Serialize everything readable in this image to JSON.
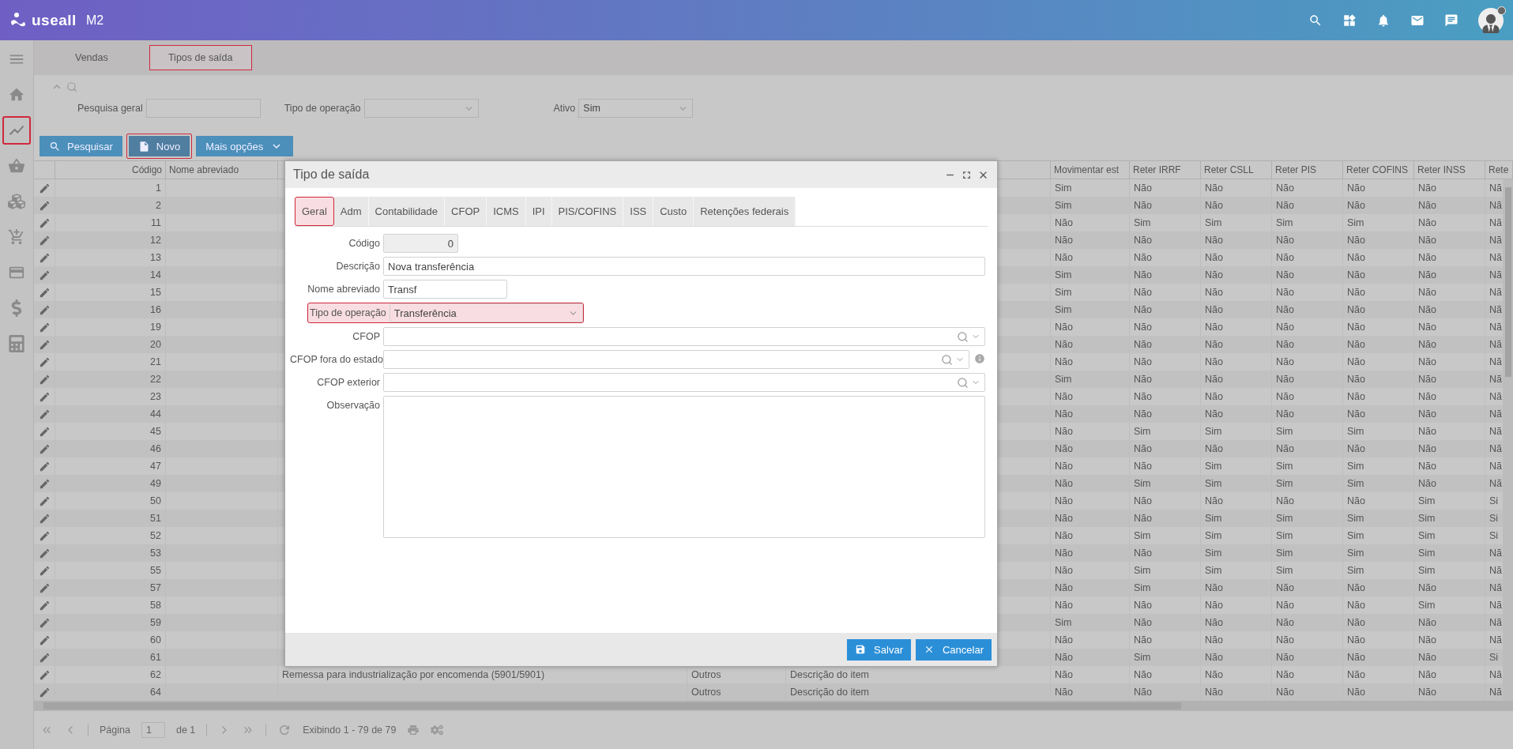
{
  "header": {
    "logo": "useall",
    "logo_suffix": "M2"
  },
  "sidebar": {
    "items": [
      {
        "kind": "menu",
        "highlighted": false
      },
      {
        "kind": "home",
        "highlighted": false
      },
      {
        "kind": "chart",
        "highlighted": true
      },
      {
        "kind": "basket",
        "highlighted": false
      },
      {
        "kind": "boxes",
        "highlighted": false
      },
      {
        "kind": "cart",
        "highlighted": false
      },
      {
        "kind": "card",
        "highlighted": false
      },
      {
        "kind": "dollar",
        "highlighted": false
      },
      {
        "kind": "calculator",
        "highlighted": false
      }
    ]
  },
  "tabs": [
    {
      "label": "Vendas",
      "selected": false,
      "highlighted": false
    },
    {
      "label": "Tipos de saída",
      "selected": true,
      "highlighted": true
    }
  ],
  "filters": {
    "fields": [
      {
        "label": "Pesquisa geral",
        "kind": "text"
      },
      {
        "label": "Tipo de operação",
        "kind": "select"
      },
      {
        "label": "Ativo",
        "kind": "select",
        "value": "Sim"
      }
    ]
  },
  "toolbar": [
    {
      "label": "Pesquisar",
      "kind": "search",
      "highlighted": false
    },
    {
      "label": "Novo",
      "kind": "new",
      "highlighted": true
    },
    {
      "label": "Mais opções",
      "kind": "more",
      "highlighted": false
    }
  ],
  "table": {
    "columns": [
      "Código",
      "Nome abreviado",
      "Movimentar est",
      "Reter IRRF",
      "Reter CSLL",
      "Reter PIS",
      "Reter COFINS",
      "Reter INSS",
      "Rete"
    ],
    "rows": [
      {
        "code": "1",
        "values": [
          "Sim",
          "Não",
          "Não",
          "Não",
          "Não",
          "Não",
          "Nã"
        ]
      },
      {
        "code": "2",
        "values": [
          "Sim",
          "Não",
          "Não",
          "Não",
          "Não",
          "Não",
          "Nã"
        ]
      },
      {
        "code": "11",
        "values": [
          "Não",
          "Sim",
          "Sim",
          "Sim",
          "Sim",
          "Não",
          "Nã"
        ]
      },
      {
        "code": "12",
        "values": [
          "Não",
          "Não",
          "Não",
          "Não",
          "Não",
          "Não",
          "Nã"
        ]
      },
      {
        "code": "13",
        "values": [
          "Não",
          "Não",
          "Não",
          "Não",
          "Não",
          "Não",
          "Nã"
        ]
      },
      {
        "code": "14",
        "values": [
          "Sim",
          "Não",
          "Não",
          "Não",
          "Não",
          "Não",
          "Nã"
        ]
      },
      {
        "code": "15",
        "values": [
          "Sim",
          "Não",
          "Não",
          "Não",
          "Não",
          "Não",
          "Nã"
        ]
      },
      {
        "code": "16",
        "values": [
          "Sim",
          "Não",
          "Não",
          "Não",
          "Não",
          "Não",
          "Nã"
        ]
      },
      {
        "code": "19",
        "values": [
          "Não",
          "Não",
          "Não",
          "Não",
          "Não",
          "Não",
          "Nã"
        ]
      },
      {
        "code": "20",
        "values": [
          "Não",
          "Não",
          "Não",
          "Não",
          "Não",
          "Não",
          "Nã"
        ]
      },
      {
        "code": "21",
        "values": [
          "Não",
          "Não",
          "Não",
          "Não",
          "Não",
          "Não",
          "Nã"
        ]
      },
      {
        "code": "22",
        "values": [
          "Sim",
          "Não",
          "Não",
          "Não",
          "Não",
          "Não",
          "Nã"
        ]
      },
      {
        "code": "23",
        "values": [
          "Não",
          "Não",
          "Não",
          "Não",
          "Não",
          "Não",
          "Nã"
        ]
      },
      {
        "code": "44",
        "values": [
          "Não",
          "Não",
          "Não",
          "Não",
          "Não",
          "Não",
          "Nã"
        ]
      },
      {
        "code": "45",
        "values": [
          "Não",
          "Sim",
          "Sim",
          "Sim",
          "Sim",
          "Não",
          "Nã"
        ]
      },
      {
        "code": "46",
        "values": [
          "Não",
          "Não",
          "Não",
          "Não",
          "Não",
          "Não",
          "Nã"
        ]
      },
      {
        "code": "47",
        "values": [
          "Não",
          "Não",
          "Sim",
          "Sim",
          "Sim",
          "Não",
          "Nã"
        ]
      },
      {
        "code": "49",
        "values": [
          "Não",
          "Sim",
          "Sim",
          "Sim",
          "Sim",
          "Não",
          "Nã"
        ]
      },
      {
        "code": "50",
        "values": [
          "Não",
          "Não",
          "Não",
          "Não",
          "Não",
          "Sim",
          "Si"
        ]
      },
      {
        "code": "51",
        "values": [
          "Não",
          "Não",
          "Sim",
          "Sim",
          "Sim",
          "Sim",
          "Si"
        ]
      },
      {
        "code": "52",
        "values": [
          "Não",
          "Sim",
          "Sim",
          "Sim",
          "Sim",
          "Sim",
          "Si"
        ]
      },
      {
        "code": "53",
        "values": [
          "Não",
          "Não",
          "Sim",
          "Sim",
          "Sim",
          "Sim",
          "Nã"
        ]
      },
      {
        "code": "55",
        "values": [
          "Não",
          "Sim",
          "Sim",
          "Sim",
          "Sim",
          "Sim",
          "Nã"
        ]
      },
      {
        "code": "57",
        "values": [
          "Não",
          "Sim",
          "Não",
          "Não",
          "Não",
          "Não",
          "Nã"
        ]
      },
      {
        "code": "58",
        "values": [
          "Não",
          "Não",
          "Não",
          "Não",
          "Não",
          "Sim",
          "Nã"
        ]
      },
      {
        "code": "59",
        "values": [
          "Sim",
          "Não",
          "Não",
          "Não",
          "Não",
          "Não",
          "Nã"
        ]
      },
      {
        "code": "60",
        "values": [
          "Não",
          "Não",
          "Não",
          "Não",
          "Não",
          "Não",
          "Nã"
        ]
      },
      {
        "code": "61",
        "values": [
          "Não",
          "Sim",
          "Não",
          "Não",
          "Não",
          "Não",
          "Si"
        ]
      },
      {
        "code": "62",
        "column_4": "Remessa para industrialização por encomenda (5901/5901)",
        "column_5": "Outros",
        "column_6": "Descrição do item",
        "values": [
          "Não",
          "Não",
          "Não",
          "Não",
          "Não",
          "Não",
          "Nã"
        ]
      },
      {
        "code": "64",
        "column_5": "Outros",
        "column_6": "Descrição do item",
        "values": [
          "Não",
          "Não",
          "Não",
          "Não",
          "Não",
          "Não",
          "Nã"
        ]
      }
    ]
  },
  "pagination": {
    "page_label": "Página",
    "page": "1",
    "of": "de 1",
    "summary": "Exibindo 1 - 79 de 79"
  },
  "dialog": {
    "title": "Tipo de saída",
    "tabs": [
      {
        "label": "Geral",
        "selected": true,
        "highlighted": true
      },
      {
        "label": "Adm",
        "selected": false,
        "highlighted": false
      },
      {
        "label": "Contabilidade",
        "selected": false,
        "highlighted": false
      },
      {
        "label": "CFOP",
        "selected": false,
        "highlighted": false
      },
      {
        "label": "ICMS",
        "selected": false,
        "highlighted": false
      },
      {
        "label": "IPI",
        "selected": false,
        "highlighted": false
      },
      {
        "label": "PIS/COFINS",
        "selected": false,
        "highlighted": false
      },
      {
        "label": "ISS",
        "selected": false,
        "highlighted": false
      },
      {
        "label": "Custo",
        "selected": false,
        "highlighted": false
      },
      {
        "label": "Retenções federais",
        "selected": false,
        "highlighted": false
      }
    ],
    "fields": [
      {
        "label": "Código",
        "kind": "number",
        "value": "0",
        "disabled": true,
        "highlighted": false
      },
      {
        "label": "Descrição",
        "kind": "text",
        "value": "Nova transferência",
        "disabled": false,
        "highlighted": false
      },
      {
        "label": "Nome abreviado",
        "kind": "short",
        "value": "Transf",
        "disabled": false,
        "highlighted": false
      },
      {
        "label": "Tipo de operação",
        "kind": "select",
        "value": "Transferência",
        "disabled": false,
        "highlighted": true
      },
      {
        "label": "CFOP",
        "kind": "lookup",
        "disabled": false,
        "highlighted": false
      },
      {
        "label": "CFOP fora do estado",
        "kind": "lookup_info",
        "disabled": false,
        "highlighted": false
      },
      {
        "label": "CFOP exterior",
        "kind": "lookup",
        "disabled": false,
        "highlighted": false
      },
      {
        "label": "Observação",
        "kind": "textarea",
        "disabled": false,
        "highlighted": false
      }
    ],
    "buttons": [
      {
        "label": "Salvar",
        "kind": "save"
      },
      {
        "label": "Cancelar",
        "kind": "cancel"
      }
    ]
  }
}
